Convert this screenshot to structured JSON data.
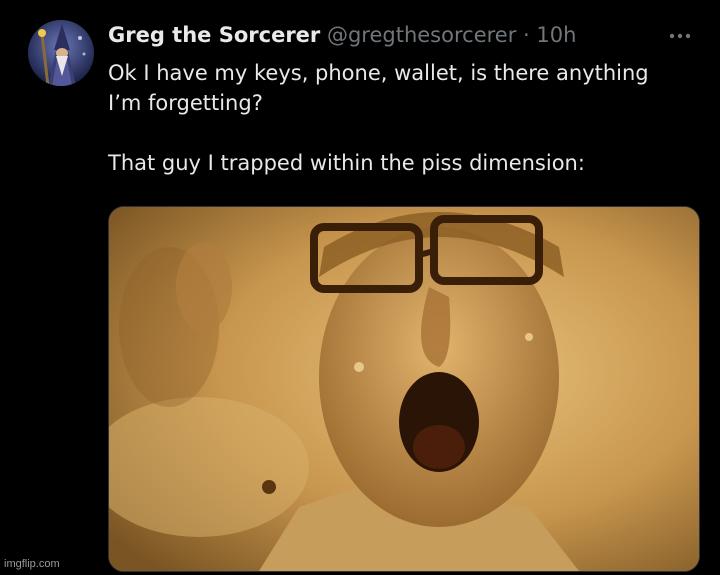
{
  "tweet": {
    "display_name": "Greg the Sorcerer",
    "handle": "@gregthesorcerer",
    "separator": "·",
    "time": "10h",
    "text_line_1": "Ok I have my keys, phone, wallet, is there anything",
    "text_line_2": "I’m forgetting?",
    "text_line_3": "That guy I trapped within the piss dimension:"
  },
  "icons": {
    "avatar": "wizard-avatar",
    "more": "more-icon"
  },
  "watermark": "imgflip.com",
  "colors": {
    "background": "#000000",
    "primary_text": "#e7e9ea",
    "secondary_text": "#71767b",
    "media_tint": "#c99a52"
  }
}
